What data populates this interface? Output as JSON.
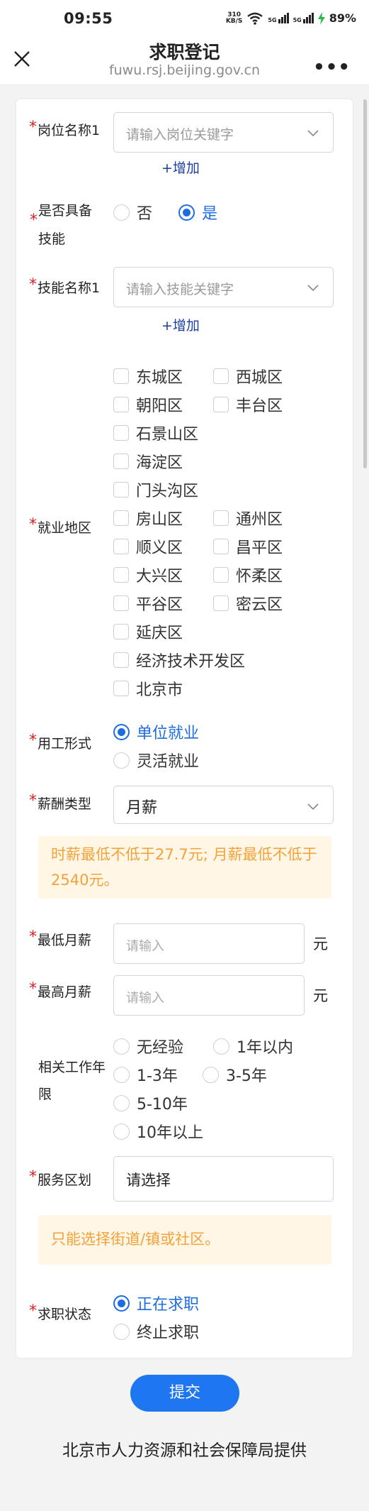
{
  "status": {
    "time": "09:55",
    "speed_value": "310",
    "speed_unit": "KB/S",
    "network_a": "5G",
    "network_b": "5G",
    "battery": "89%"
  },
  "titlebar": {
    "title": "求职登记",
    "url": "fuwu.rsj.beijing.gov.cn",
    "more": "•••"
  },
  "form": {
    "job_name": {
      "label": "岗位名称1",
      "placeholder": "请输入岗位关键字",
      "add": "+增加"
    },
    "has_skill": {
      "label_line1": "是否具备",
      "label_line2": "技能",
      "options": [
        "否",
        "是"
      ],
      "selected": "是"
    },
    "skill_name": {
      "label": "技能名称1",
      "placeholder": "请输入技能关键字",
      "add": "+增加"
    },
    "area": {
      "label": "就业地区",
      "options": [
        "东城区",
        "西城区",
        "朝阳区",
        "丰台区",
        "石景山区",
        "海淀区",
        "门头沟区",
        "房山区",
        "通州区",
        "顺义区",
        "昌平区",
        "大兴区",
        "怀柔区",
        "平谷区",
        "密云区",
        "延庆区",
        "经济技术开发区",
        "北京市"
      ]
    },
    "employment_type": {
      "label": "用工形式",
      "options": [
        "单位就业",
        "灵活就业"
      ],
      "selected": "单位就业"
    },
    "salary_type": {
      "label": "薪酬类型",
      "value": "月薪"
    },
    "salary_notice": "时薪最低不低于27.7元; 月薪最低不低于2540元。",
    "min_salary": {
      "label": "最低月薪",
      "placeholder": "请输入",
      "unit": "元"
    },
    "max_salary": {
      "label": "最高月薪",
      "placeholder": "请输入",
      "unit": "元"
    },
    "experience": {
      "label_line1": "相关工作年",
      "label_line2": "限",
      "options": [
        "无经验",
        "1年以内",
        "1-3年",
        "3-5年",
        "5-10年",
        "10年以上"
      ]
    },
    "service_area": {
      "label": "服务区划",
      "value": "请选择"
    },
    "service_notice": "只能选择街道/镇或社区。",
    "job_status": {
      "label": "求职状态",
      "options": [
        "正在求职",
        "终止求职"
      ],
      "selected": "正在求职"
    }
  },
  "submit_label": "提交",
  "footer": "北京市人力资源和社会保障局提供",
  "colors": {
    "accent": "#1e76f0",
    "required": "#e02020",
    "notice_bg": "#fff6e6",
    "notice_text": "#f3a23a"
  }
}
